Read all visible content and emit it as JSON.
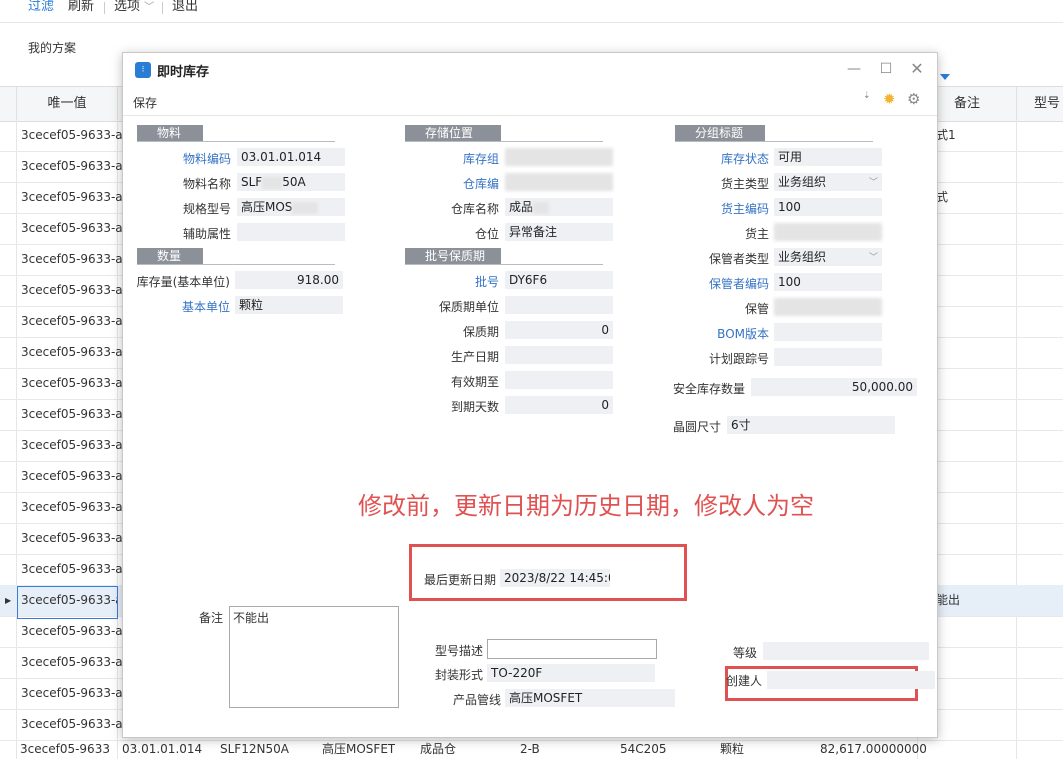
{
  "toolbar": {
    "filter": "过滤",
    "refresh": "刷新",
    "options": "选项",
    "exit": "退出"
  },
  "scheme_label": "我的方案",
  "grid": {
    "headers": {
      "unique": "唯一值",
      "remark": "备注",
      "model": "型号"
    },
    "row_value": "3cecef05-9633-a",
    "remark_values": {
      "r1": "式1",
      "r3": "式",
      "sel": "能出"
    },
    "last_row": {
      "c1": "3cecef05-9633",
      "c2": "03.01.01.014",
      "c3": "SLF12N50A",
      "c4": "高压MOSFET",
      "c5": "成品仓",
      "c6": "2-B",
      "c7": "54C205",
      "c8": "颗粒",
      "c9": "82,617.00000000"
    }
  },
  "dialog": {
    "title": "即时库存",
    "save": "保存",
    "sections": {
      "material": "物料",
      "storage": "存储位置",
      "group": "分组标题",
      "quantity": "数量",
      "batch": "批号保质期"
    },
    "material": {
      "code_label": "物料编码",
      "code": "03.01.01.014",
      "name_label": "物料名称",
      "name": "SLF",
      "name_tail": "50A",
      "spec_label": "规格型号",
      "spec": "高压MOS",
      "aux_label": "辅助属性"
    },
    "storage": {
      "org_label": "库存组",
      "wh_code_label": "仓库编",
      "wh_name_label": "仓库名称",
      "wh_name": "成品",
      "loc_label": "仓位",
      "loc": "异常备注"
    },
    "group": {
      "status_label": "库存状态",
      "status": "可用",
      "owner_type_label": "货主类型",
      "owner_type": "业务组织",
      "owner_code_label": "货主编码",
      "owner_code": "100",
      "owner_name_label": "货主",
      "keeper_type_label": "保管者类型",
      "keeper_type": "业务组织",
      "keeper_code_label": "保管者编码",
      "keeper_code": "100",
      "keeper_name_label": "保管",
      "bom_label": "BOM版本",
      "track_label": "计划跟踪号",
      "safety_label": "安全库存数量",
      "safety": "50,000.00",
      "wafer_label": "晶圆尺寸",
      "wafer": "6寸"
    },
    "quantity": {
      "qty_label": "库存量(基本单位)",
      "qty": "918.00",
      "unit_label": "基本单位",
      "unit": "颗粒"
    },
    "batch": {
      "lot_label": "批号",
      "lot": "DY6F6",
      "shelf_unit_label": "保质期单位",
      "shelf_label": "保质期",
      "shelf": "0",
      "prod_label": "生产日期",
      "exp_label": "有效期至",
      "days_label": "到期天数",
      "days": "0"
    },
    "annotation": "修改前，更新日期为历史日期，修改人为空",
    "last_update_label": "最后更新日期",
    "last_update": "2023/8/22 14:45:09",
    "remark_label": "备注",
    "remark": "不能出",
    "model_desc_label": "型号描述",
    "model_desc": "",
    "package_label": "封装形式",
    "package": "TO-220F",
    "product_line_label": "产品管线",
    "product_line": "高压MOSFET",
    "grade_label": "等级",
    "creator_label": "创建人",
    "creator": ""
  }
}
